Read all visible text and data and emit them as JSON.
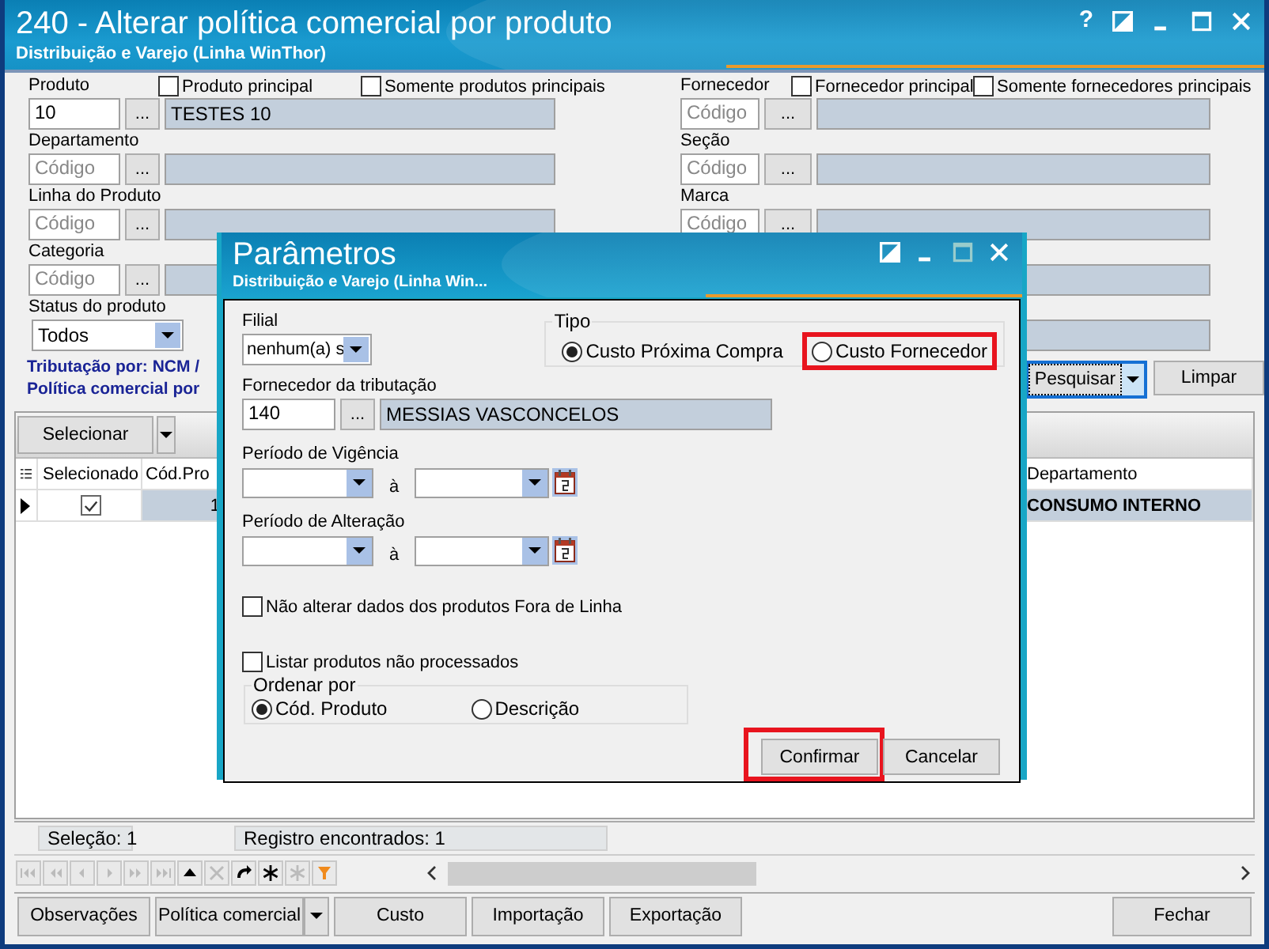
{
  "window": {
    "title": "240 - Alterar política comercial por produto",
    "subtitle": "Distribuição e Varejo (Linha WinThor)",
    "help": "?"
  },
  "filters_left": [
    {
      "label": "Produto",
      "checkboxes": [
        {
          "label": "Produto principal",
          "checked": false
        },
        {
          "label": "Somente produtos principais",
          "checked": false
        }
      ],
      "code": {
        "value": "10",
        "browse": "..."
      },
      "description": "TESTES 10"
    },
    {
      "label": "Departamento",
      "code": {
        "placeholder": "Código",
        "browse": "..."
      }
    },
    {
      "label": "Linha do Produto",
      "code": {
        "placeholder": "Código",
        "browse": "..."
      }
    },
    {
      "label": "Categoria",
      "code": {
        "placeholder": "Código",
        "browse": "..."
      }
    }
  ],
  "status_produto": {
    "label": "Status do produto",
    "value": "Todos"
  },
  "info_lines": [
    "Tributação por: NCM /",
    "Política comercial por"
  ],
  "filters_right": [
    {
      "kind": "lookup",
      "label": "Fornecedor",
      "checkboxes": [
        {
          "label": "Fornecedor principal",
          "checked": false
        },
        {
          "label": "Somente fornecedores principais",
          "checked": false
        }
      ],
      "code": {
        "placeholder": "Código",
        "browse": "..."
      }
    },
    {
      "kind": "lookup",
      "label": "Seção",
      "code": {
        "placeholder": "Código",
        "browse": "..."
      }
    },
    {
      "kind": "lookup",
      "label": "Marca",
      "code": {
        "placeholder": "Código",
        "browse": "..."
      }
    },
    {
      "kind": "description"
    },
    {
      "kind": "description"
    }
  ],
  "search_buttons": [
    {
      "kind": "split",
      "label": "Pesquisar",
      "focused": true
    },
    {
      "kind": "plain",
      "label": "Limpar",
      "focused": false
    }
  ],
  "grid": {
    "select_button": "Selecionar",
    "columns": [
      {
        "label": "Selecionado"
      },
      {
        "label": "Cód.Pro"
      },
      {
        "label": "Departamento"
      }
    ],
    "rows": [
      {
        "current": true,
        "selected": true,
        "checked": true,
        "code": "1",
        "department": "CONSUMO INTERNO"
      }
    ]
  },
  "status_bar": [
    "Seleção: 1",
    "Registro encontrados: 1"
  ],
  "bottom_buttons": [
    {
      "kind": "plain",
      "label": "Observações"
    },
    {
      "kind": "split",
      "label": "Política comercial"
    },
    {
      "kind": "plain",
      "label": "Custo"
    },
    {
      "kind": "plain",
      "label": "Importação"
    },
    {
      "kind": "plain",
      "label": "Exportação"
    },
    {
      "kind": "plain",
      "label": "Fechar"
    }
  ],
  "dialog": {
    "title": "Parâmetros",
    "subtitle": "Distribuição e Varejo (Linha Win...",
    "filial": {
      "label": "Filial",
      "value": "nenhum(a) s"
    },
    "tipo": {
      "label": "Tipo",
      "options": [
        {
          "label": "Custo Próxima Compra",
          "selected": true,
          "highlighted": false
        },
        {
          "label": "Custo Fornecedor",
          "selected": false,
          "highlighted": true
        }
      ]
    },
    "fornecedor_tributacao": {
      "label": "Fornecedor da tributação",
      "code": "140",
      "browse": "...",
      "name": "MESSIAS VASCONCELOS"
    },
    "periods": [
      {
        "label": "Período de Vigência",
        "separator": "à"
      },
      {
        "label": "Período de Alteração",
        "separator": "à"
      }
    ],
    "checkboxes": [
      {
        "label": "Não alterar dados dos produtos Fora de Linha",
        "checked": false
      },
      {
        "label": "Listar produtos não processados",
        "checked": false
      }
    ],
    "ordenar": {
      "label": "Ordenar por",
      "options": [
        {
          "label": "Cód. Produto",
          "selected": true
        },
        {
          "label": "Descrição",
          "selected": false
        }
      ]
    },
    "buttons": [
      {
        "label": "Confirmar",
        "highlighted": true
      },
      {
        "label": "Cancelar",
        "highlighted": false
      }
    ]
  }
}
